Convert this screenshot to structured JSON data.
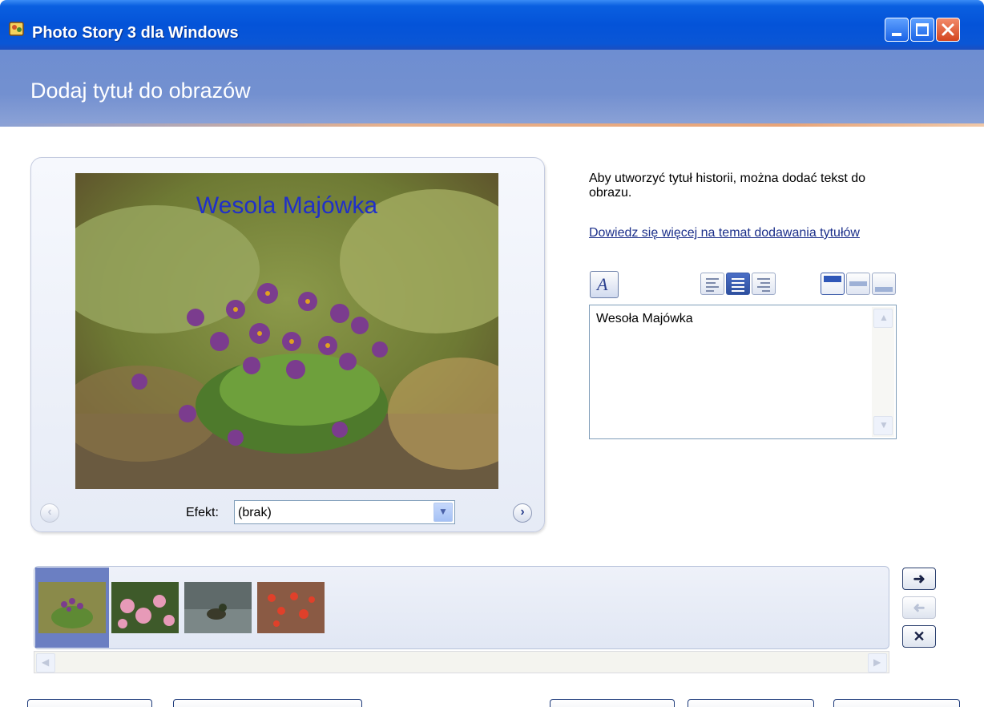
{
  "window": {
    "title": "Photo Story 3 dla Windows",
    "app_icon": "photo-story-icon",
    "controls": [
      "minimize-icon",
      "maximize-icon",
      "close-icon"
    ]
  },
  "header": {
    "title": "Dodaj tytuł do obrazów"
  },
  "preview": {
    "overlay_title": "Wesola Majówka",
    "effect_label": "Efekt:",
    "effect_value": "(brak)"
  },
  "panel": {
    "description": "Aby utworzyć tytuł historii, można dodać tekst do obrazu.",
    "help_link": "Dowiedz się więcej na temat dodawania tytułów",
    "title_text": "Wesoła Majówka",
    "toolbar_icons": [
      "font-icon",
      "align-left-icon",
      "align-center-icon",
      "align-right-icon",
      "position-top-icon",
      "position-middle-icon",
      "position-bottom-icon"
    ]
  },
  "filmstrip": {
    "thumbnails": [
      "pasque-flower",
      "pink-flowers",
      "duck-on-water",
      "red-flowers"
    ],
    "selected_index": 0,
    "side_icons": [
      "move-right-icon",
      "move-left-icon",
      "remove-icon"
    ]
  },
  "colors": {
    "titlebar": "#0453d8",
    "header": "#7390d0",
    "link": "#1b2f8a",
    "selection": "#6b7fc2"
  }
}
